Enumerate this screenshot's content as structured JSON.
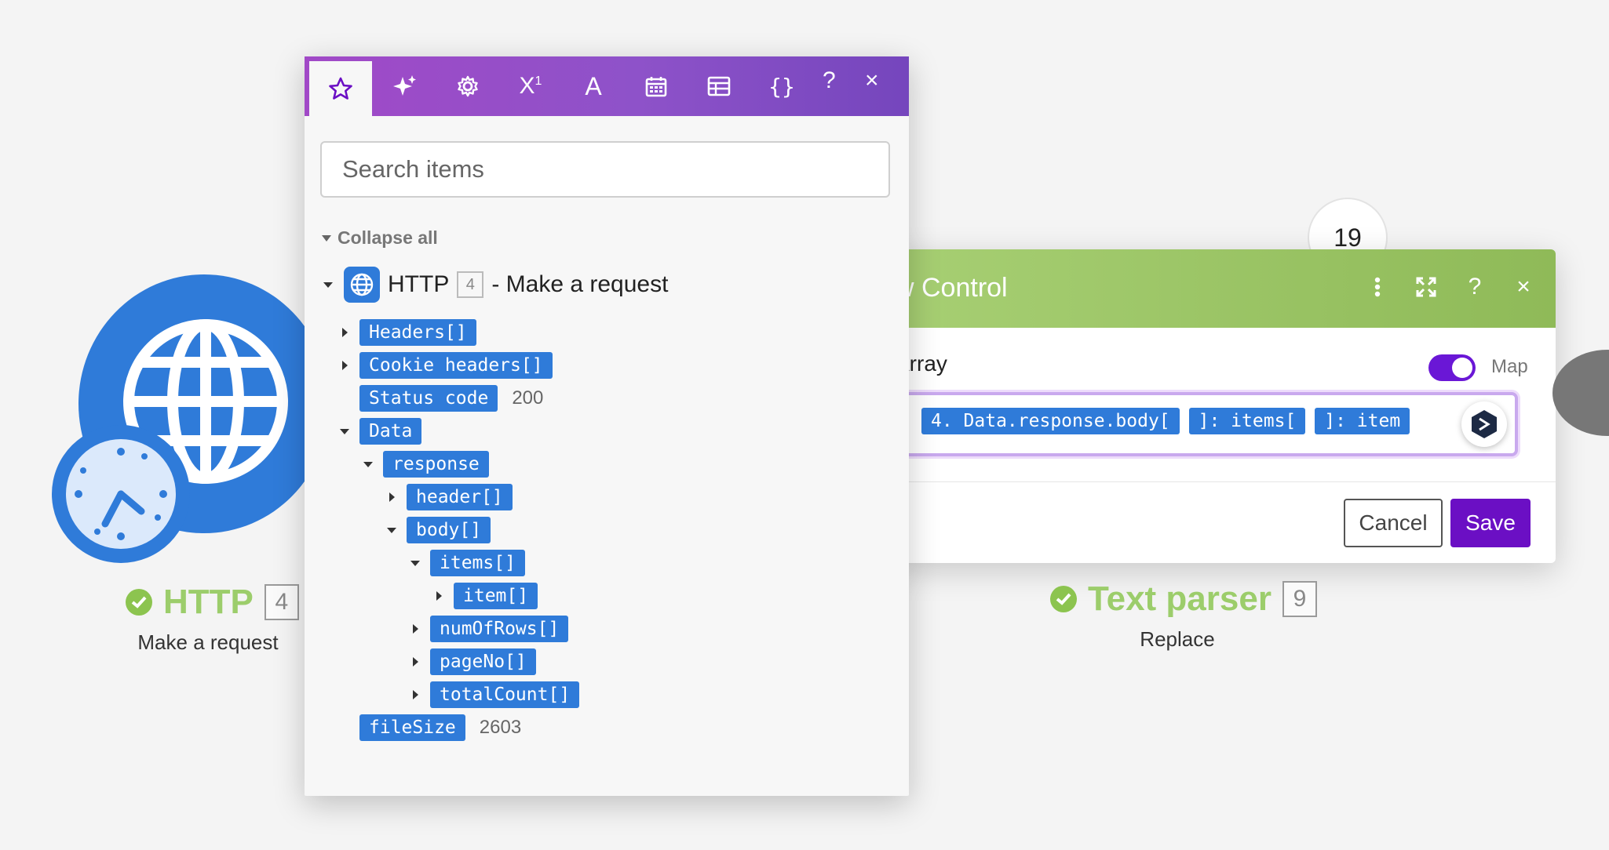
{
  "http_node": {
    "name": "HTTP",
    "number": "4",
    "subtitle": "Make a request"
  },
  "text_parser_node": {
    "name": "Text parser",
    "number": "9",
    "subtitle": "Replace"
  },
  "operation_counter": "19",
  "config_panel": {
    "title": "w Control",
    "field_label": "Array",
    "map_label": "Map",
    "map_enabled": true,
    "mapping_pills": [
      "4. Data.response.body[",
      "]: items[",
      "]: item"
    ],
    "cancel_label": "Cancel",
    "save_label": "Save",
    "header_color": "#9cc566",
    "save_color": "#6b0fc4"
  },
  "popup": {
    "tabs": [
      "star-icon",
      "sparkles-icon",
      "gear-icon",
      "superscript-icon",
      "text-icon",
      "calendar-icon",
      "table-icon",
      "braces-icon"
    ],
    "help_label": "?",
    "close_label": "×",
    "search_placeholder": "Search items",
    "collapse_all": "Collapse all",
    "module": {
      "name": "HTTP",
      "number": "4",
      "description": "- Make a request"
    },
    "tree": [
      {
        "label": "Headers[]"
      },
      {
        "label": "Cookie headers[]"
      },
      {
        "label": "Status code",
        "value": "200"
      },
      {
        "label": "Data"
      },
      {
        "label": "response"
      },
      {
        "label": "header[]"
      },
      {
        "label": "body[]"
      },
      {
        "label": "items[]"
      },
      {
        "label": "item[]"
      },
      {
        "label": "numOfRows[]"
      },
      {
        "label": "pageNo[]"
      },
      {
        "label": "totalCount[]"
      },
      {
        "label": "fileSize",
        "value": "2603"
      }
    ],
    "accent_color": "#8e52c9"
  }
}
